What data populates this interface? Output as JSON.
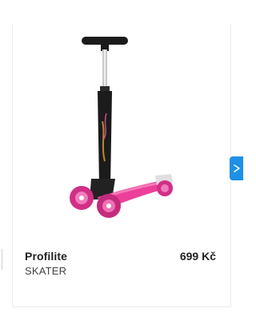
{
  "product": {
    "name": "Profilite",
    "brand": "SKATER",
    "price": "699 Kč",
    "image_icon": "pink-scooter-image"
  },
  "carousel": {
    "next_icon": "chevron-right-icon",
    "accent_color": "#1e90e6"
  },
  "colors": {
    "scooter_pink": "#ec3f9a",
    "scooter_black": "#1b1b1b"
  }
}
